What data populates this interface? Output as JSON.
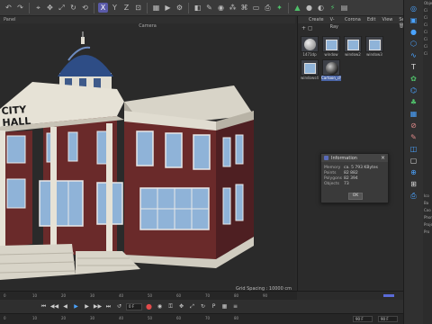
{
  "toolbar": {
    "axis_x": "X",
    "axis_y": "Y",
    "axis_z": "Z"
  },
  "viewport": {
    "panel_label": "Panel",
    "camera_label": "Camera",
    "grid_spacing": "Grid Spacing : 10000 cm",
    "building_sign": "CITY HALL"
  },
  "material_manager": {
    "menu": [
      "Create",
      "V-Ray",
      "Corona",
      "Edit",
      "View",
      "Select"
    ],
    "materials": [
      {
        "label": "1471dp",
        "selected": false
      },
      {
        "label": "window",
        "selected": false
      },
      {
        "label": "window2",
        "selected": false
      },
      {
        "label": "window3",
        "selected": false
      },
      {
        "label": "windows4",
        "selected": false
      },
      {
        "label": "Cartoon_ch",
        "selected": true
      }
    ]
  },
  "info_dialog": {
    "title": "Information",
    "rows": [
      {
        "key": "Memory",
        "value": "ca. 5 793 KBytes"
      },
      {
        "key": "Points",
        "value": "82 882"
      },
      {
        "key": "Polygons",
        "value": "82 394"
      },
      {
        "key": "Objects",
        "value": "73"
      }
    ],
    "ok_label": "OK"
  },
  "timeline": {
    "ticks": [
      "0",
      "10",
      "20",
      "30",
      "40",
      "50",
      "60",
      "70",
      "80",
      "90"
    ],
    "frame_field": "0 F",
    "bottom_fields": [
      "90 F",
      "90 F"
    ]
  },
  "object_panel": {
    "title": "Obje",
    "rows": [
      "Ci",
      "Ci",
      "Ci",
      "Ci",
      "Ci",
      "Ci",
      "Ci"
    ],
    "lower": [
      "Ico",
      "Ba",
      "Coo",
      "Phon",
      "Projec",
      "Pro"
    ]
  },
  "colors": {
    "accent": "#5a6bd8",
    "selection": "#4b66a8",
    "record": "#e24a4a"
  }
}
